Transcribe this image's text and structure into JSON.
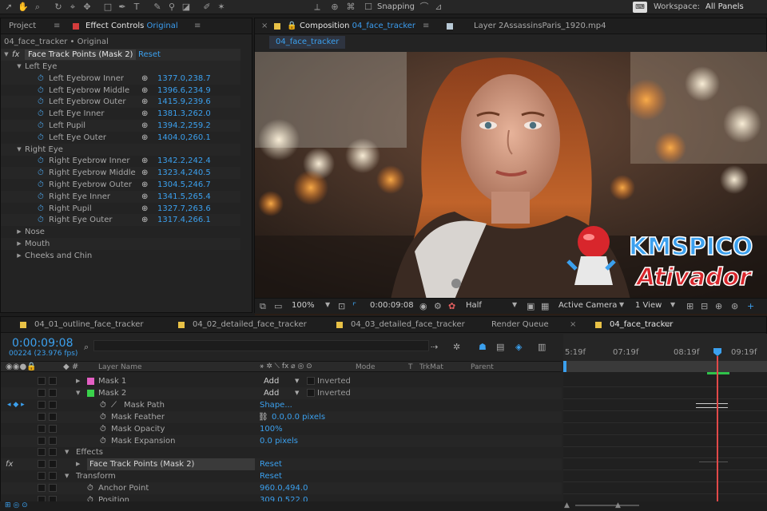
{
  "toolbar": {
    "snapping_label": "Snapping",
    "workspace_label": "Workspace:",
    "workspace_value": "All Panels"
  },
  "effect_controls": {
    "tabs": {
      "project": "Project",
      "effect_controls": "Effect Controls",
      "effect_controls_target": "Original"
    },
    "header": "04_face_tracker • Original",
    "effect_name": "Face Track Points (Mask 2)",
    "reset_label": "Reset",
    "groups": [
      {
        "label": "Left Eye",
        "items": [
          {
            "label": "Left Eyebrow Inner",
            "value": "1377.0,238.7"
          },
          {
            "label": "Left Eyebrow Middle",
            "value": "1396.6,234.9"
          },
          {
            "label": "Left Eyebrow Outer",
            "value": "1415.9,239.6"
          },
          {
            "label": "Left Eye Inner",
            "value": "1381.3,262.0"
          },
          {
            "label": "Left Pupil",
            "value": "1394.2,259.2"
          },
          {
            "label": "Left Eye Outer",
            "value": "1404.0,260.1"
          }
        ]
      },
      {
        "label": "Right Eye",
        "items": [
          {
            "label": "Right Eyebrow Inner",
            "value": "1342.2,242.4"
          },
          {
            "label": "Right Eyebrow Middle",
            "value": "1323.4,240.5"
          },
          {
            "label": "Right Eyebrow Outer",
            "value": "1304.5,246.7"
          },
          {
            "label": "Right Eye Inner",
            "value": "1341.5,265.4"
          },
          {
            "label": "Right Pupil",
            "value": "1327.7,263.6"
          },
          {
            "label": "Right Eye Outer",
            "value": "1317.4,266.1"
          }
        ]
      }
    ],
    "collapsed_groups": [
      "Nose",
      "Mouth",
      "Cheeks and Chin"
    ]
  },
  "composition": {
    "tab_prefix": "Composition",
    "tab_name": "04_face_tracker",
    "layer_tab": "Layer 2AssassinsParis_1920.mp4",
    "breadcrumb": "04_face_tracker",
    "watermark_line1": "KMSPICO",
    "watermark_line2": "Ativador",
    "footer": {
      "zoom": "100%",
      "timecode": "0:00:09:08",
      "resolution": "Half",
      "camera": "Active Camera",
      "view": "1 View"
    }
  },
  "timeline": {
    "tabs": [
      "04_01_outline_face_tracker",
      "04_02_detailed_face_tracker",
      "04_03_detailed_face_tracker",
      "Render Queue",
      "04_face_tracker"
    ],
    "timecode": "0:00:09:08",
    "frame_info": "00224 (23.976 fps)",
    "search_placeholder": "",
    "columns": {
      "layer_name": "Layer Name",
      "mode": "Mode",
      "t": "T",
      "trkmat": "TrkMat",
      "parent": "Parent"
    },
    "ruler": [
      "5:19f",
      "07:19f",
      "08:19f",
      "09:19f"
    ],
    "rows": [
      {
        "label": "Mask 1",
        "mode": "Add",
        "inverted": "Inverted",
        "color": "#e35fc3"
      },
      {
        "label": "Mask 2",
        "mode": "Add",
        "inverted": "Inverted",
        "color": "#3ad24b"
      },
      {
        "label": "Mask Path",
        "value": "Shape..."
      },
      {
        "label": "Mask Feather",
        "value": "0.0,0.0 pixels"
      },
      {
        "label": "Mask Opacity",
        "value": "100%"
      },
      {
        "label": "Mask Expansion",
        "value": "0.0 pixels"
      },
      {
        "label": "Effects"
      },
      {
        "label": "Face Track Points (Mask 2)",
        "value": "Reset"
      },
      {
        "label": "Transform",
        "value": "Reset"
      },
      {
        "label": "Anchor Point",
        "value": "960.0,494.0"
      },
      {
        "label": "Position",
        "value": "309.0,522.0"
      }
    ]
  },
  "colors": {
    "accent": "#3ba0ee",
    "comp_tab": "#e8c146",
    "playhead": "#e24949"
  }
}
